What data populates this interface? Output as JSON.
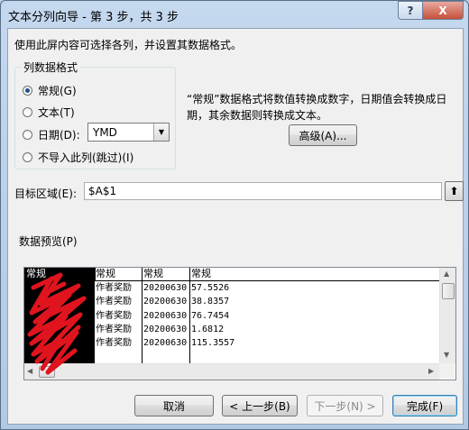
{
  "window": {
    "title": "文本分列向导 - 第 3 步，共 3 步",
    "help": "?",
    "close": "X"
  },
  "instruction": "使用此屏内容可选择各列，并设置其数据格式。",
  "column_format": {
    "title": "列数据格式",
    "options": [
      {
        "label": "常规(G)",
        "checked": true
      },
      {
        "label": "文本(T)",
        "checked": false
      },
      {
        "label": "日期(D):",
        "checked": false
      },
      {
        "label": "不导入此列(跳过)(I)",
        "checked": false
      }
    ],
    "date_format": "YMD"
  },
  "description": "“常规”数据格式将数值转换成数字，日期值会转换成日期，其余数据则转换成文本。",
  "advanced_button": "高级(A)...",
  "destination": {
    "label": "目标区域(E):",
    "value": "$A$1"
  },
  "preview": {
    "label": "数据预览(P)",
    "headers": [
      "常规",
      "常规",
      "常规",
      "常规"
    ],
    "rows": [
      [
        "",
        "作者奖励",
        "20200630",
        "57.5526"
      ],
      [
        "",
        "作者奖励",
        "20200630",
        "38.8357"
      ],
      [
        "",
        "作者奖励",
        "20200630",
        "76.7454"
      ],
      [
        "",
        "作者奖励",
        "20200630",
        "1.6812"
      ],
      [
        "",
        "作者奖励",
        "20200630",
        "115.3557"
      ]
    ]
  },
  "buttons": {
    "cancel": "取消",
    "back": "< 上一步(B)",
    "next": "下一步(N) >",
    "finish": "完成(F)"
  },
  "colors": {
    "redaction": "#e0141e",
    "selected_column": "#000000"
  }
}
